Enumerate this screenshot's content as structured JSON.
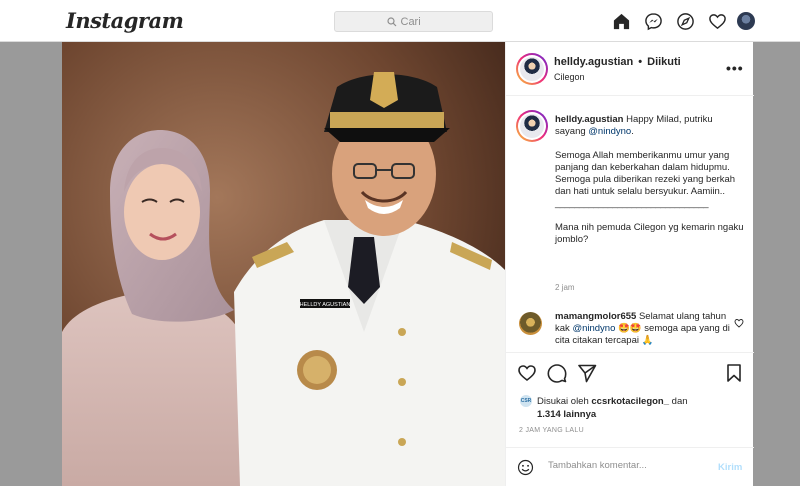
{
  "header": {
    "logo": "Instagram",
    "search_placeholder": "Cari"
  },
  "nav_icons": [
    "home-icon",
    "messenger-icon",
    "explore-icon",
    "heart-icon",
    "profile-avatar"
  ],
  "post": {
    "photo_name_tag": "HELLDY AGUSTIAN",
    "author": "helldy.agustian",
    "follow_status": "Diikuti",
    "location": "Cilegon",
    "caption": {
      "username": "helldy.agustian",
      "line1": "Happy Milad, putriku sayang",
      "mention": "@nindyno",
      "line1_end": ".",
      "para2": "Semoga Allah memberikanmu umur yang panjang dan keberkahan dalam hidupmu. Semoga pula diberikan rezeki yang berkah dan hati untuk selalu bersyukur. Aamiin..",
      "divider": "________________________________",
      "para3": "Mana nih pemuda Cilegon yg kemarin ngaku jomblo?",
      "time": "2 jam"
    },
    "comment": {
      "username": "mamangmolor655",
      "text_before": "Selamat ulang tahun kak",
      "mention": "@nindyno",
      "text_after": "🤩🤩 semoga apa yang di cita citakan tercapai 🙏"
    },
    "likes": {
      "avatar_text": "CSR",
      "prefix": "Disukai oleh",
      "liker": "ccsrkotacilegon_",
      "connector": "dan",
      "others": "1.314 lainnya"
    },
    "date": "2 JAM YANG LALU",
    "add_comment_placeholder": "Tambahkan komentar...",
    "send_label": "Kirim"
  },
  "colors": {
    "link": "#00376b",
    "send_disabled": "#b2dffc",
    "border": "#dbdbdb",
    "muted": "#8e8e8e"
  }
}
